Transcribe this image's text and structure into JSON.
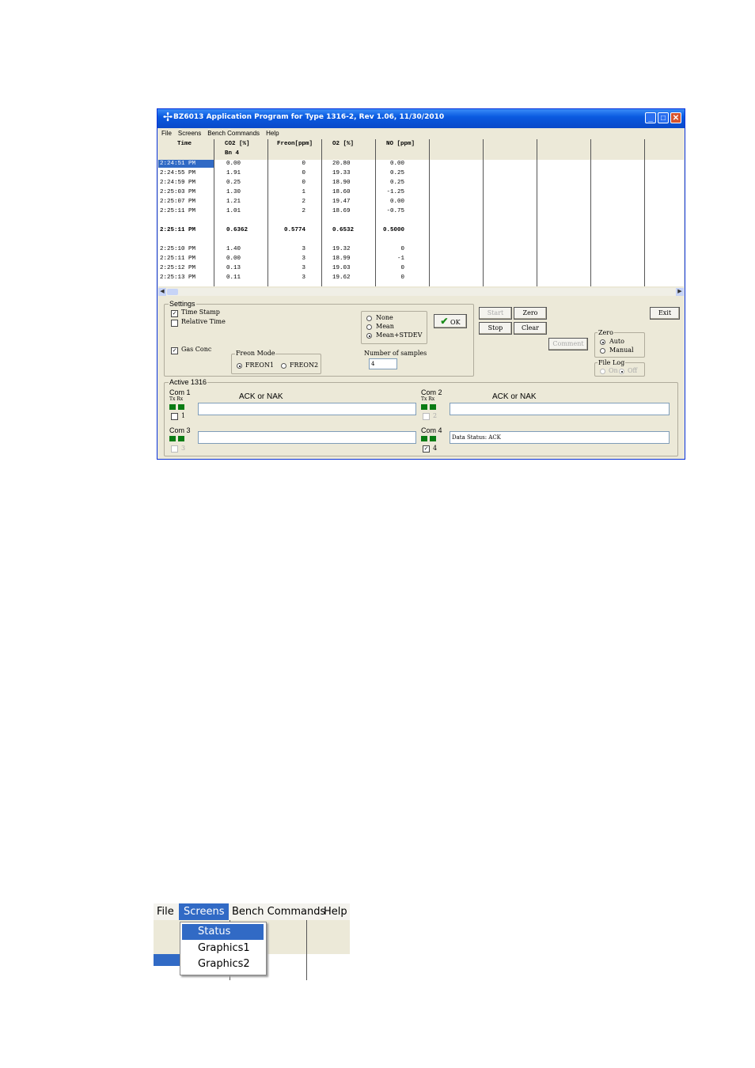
{
  "window": {
    "title": "BZ6013 Application Program for Type 1316-2, Rev 1.06, 11/30/2010",
    "buttons": [
      "_",
      "□",
      "✕"
    ]
  },
  "menu": [
    "File",
    "Screens",
    "Bench Commands",
    "Help"
  ],
  "table": {
    "headers": [
      "Time",
      "CO2 [%]",
      "Freon[ppm]",
      "O2 [%]",
      "NO [ppm]"
    ],
    "subheader": "Bn 4",
    "rows": [
      [
        "2:24:51 PM",
        "0.00",
        "0",
        "20.80",
        "0.00"
      ],
      [
        "2:24:55 PM",
        "1.91",
        "0",
        "19.33",
        "0.25"
      ],
      [
        "2:24:59 PM",
        "0.25",
        "0",
        "18.90",
        "0.25"
      ],
      [
        "2:25:03 PM",
        "1.30",
        "1",
        "18.60",
        "-1.25"
      ],
      [
        "2:25:07 PM",
        "1.21",
        "2",
        "19.47",
        "0.00"
      ],
      [
        "2:25:11 PM",
        "1.01",
        "2",
        "18.69",
        "-0.75"
      ],
      [
        "",
        "",
        "",
        "",
        ""
      ],
      [
        "2:25:11 PM",
        "0.6362",
        "0.5774",
        "0.6532",
        "0.5000"
      ],
      [
        "",
        "",
        "",
        "",
        ""
      ],
      [
        "2:25:10 PM",
        "1.40",
        "3",
        "19.32",
        "0"
      ],
      [
        "2:25:11 PM",
        "0.00",
        "3",
        "18.99",
        "-1"
      ],
      [
        "2:25:12 PM",
        "0.13",
        "3",
        "19.03",
        "0"
      ],
      [
        "2:25:13 PM",
        "0.11",
        "3",
        "19.62",
        "0"
      ]
    ]
  },
  "settings": {
    "label": "Settings",
    "time_stamp": "Time Stamp",
    "relative_time": "Relative Time",
    "gas_conc": "Gas Conc",
    "freon_mode_label": "Freon Mode",
    "freon1": "FREON1",
    "freon2": "FREON2",
    "stats": [
      "None",
      "Mean",
      "Mean+STDEV"
    ],
    "ok": "OK",
    "num_samples_label": "Number of samples",
    "num_samples": "4"
  },
  "controls": {
    "start": "Start",
    "zero": "Zero",
    "stop": "Stop",
    "clear": "Clear",
    "comment": "Comment",
    "exit": "Exit",
    "zero_group": "Zero",
    "auto": "Auto",
    "manual": "Manual",
    "file_log": "File Log",
    "on": "On",
    "off": "Off"
  },
  "active": {
    "label": "Active 1316",
    "txrx": "Tx Rx",
    "com1": "Com 1",
    "com2": "Com 2",
    "com3": "Com 3",
    "com4": "Com 4",
    "ack1": "ACK or NAK",
    "ack2": "ACK or NAK",
    "n1": "1",
    "n2": "2",
    "n3": "3",
    "n4": "4",
    "com4_status": "Data Status: ACK"
  },
  "zoom_menu": {
    "items": [
      "File",
      "Screens",
      "Bench Commands",
      "Help"
    ],
    "dropdown": [
      "Status",
      "Graphics1",
      "Graphics2"
    ]
  },
  "colors": {
    "title_blue": "#0a5ae0",
    "selection": "#316ac5",
    "led_green": "#0a7c14"
  }
}
